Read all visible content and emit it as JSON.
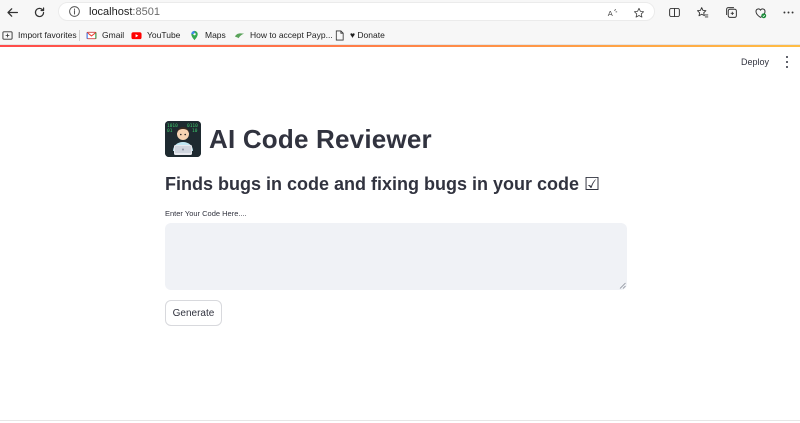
{
  "browser": {
    "url_host": "localhost",
    "url_port": ":8501",
    "icons": [
      "back-icon",
      "refresh-icon",
      "info-icon",
      "read-aloud-icon",
      "favorite-star-icon",
      "split-screen-icon",
      "favorites-icon",
      "collections-icon",
      "browser-essentials-icon",
      "more-icon"
    ]
  },
  "bookmarks": [
    {
      "label": "Import favorites",
      "icon": "import-favorites-icon"
    },
    {
      "label": "Gmail",
      "icon": "gmail-icon"
    },
    {
      "label": "YouTube",
      "icon": "youtube-icon"
    },
    {
      "label": "Maps",
      "icon": "maps-icon"
    },
    {
      "label": "How to accept Payp...",
      "icon": "paypal-bookmark-icon"
    },
    {
      "label": "♥ Donate",
      "icon": "page-icon"
    }
  ],
  "app": {
    "deploy_label": "Deploy",
    "title": "AI Code Reviewer",
    "subtitle": "Finds bugs in code and fixing bugs in your code ☑",
    "input_label": "Enter Your Code Here....",
    "input_value": "",
    "button_label": "Generate",
    "accent_colors": [
      "#ff4b4b",
      "#ffbd45"
    ]
  }
}
